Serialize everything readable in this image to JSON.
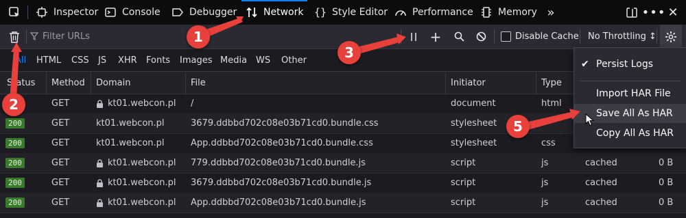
{
  "tabs": [
    {
      "label": "Inspector",
      "icon": "inspector-icon"
    },
    {
      "label": "Console",
      "icon": "console-icon"
    },
    {
      "label": "Debugger",
      "icon": "debugger-icon"
    },
    {
      "label": "Network",
      "icon": "network-icon",
      "active": true
    },
    {
      "label": "Style Editor",
      "icon": "style-editor-icon"
    },
    {
      "label": "Performance",
      "icon": "performance-icon"
    },
    {
      "label": "Memory",
      "icon": "memory-icon"
    }
  ],
  "filterbar": {
    "filter_placeholder": "Filter URLs",
    "disable_cache_label": "Disable Cache",
    "throttling_label": "No Throttling ↕"
  },
  "type_filters": [
    "All",
    "HTML",
    "CSS",
    "JS",
    "XHR",
    "Fonts",
    "Images",
    "Media",
    "WS",
    "Other"
  ],
  "columns": [
    "Status",
    "Method",
    "Domain",
    "File",
    "Initiator",
    "Type"
  ],
  "rows": [
    {
      "status": "",
      "method": "GET",
      "domain": "kt01.webcon.pl",
      "lock": true,
      "file": "/",
      "initiator": "document",
      "type": "html",
      "transferred": "",
      "size": ""
    },
    {
      "status": "200",
      "method": "GET",
      "domain": "kt01.webcon.pl",
      "lock": false,
      "file": "3679.ddbbd702c08e03b71cd0.bundle.css",
      "initiator": "stylesheet",
      "type": "",
      "transferred": "",
      "size": ""
    },
    {
      "status": "200",
      "method": "GET",
      "domain": "kt01.webcon.pl",
      "lock": false,
      "file": "App.ddbbd702c08e03b71cd0.bundle.css",
      "initiator": "stylesheet",
      "type": "css",
      "transferred": "",
      "size": ""
    },
    {
      "status": "200",
      "method": "GET",
      "domain": "kt01.webcon.pl",
      "lock": true,
      "file": "779.ddbbd702c08e03b71cd0.bundle.js",
      "initiator": "script",
      "type": "js",
      "transferred": "cached",
      "size": "0 B"
    },
    {
      "status": "200",
      "method": "GET",
      "domain": "kt01.webcon.pl",
      "lock": true,
      "file": "3679.ddbbd702c08e03b71cd0.bundle.js",
      "initiator": "script",
      "type": "js",
      "transferred": "cached",
      "size": "0 B"
    },
    {
      "status": "200",
      "method": "GET",
      "domain": "kt01.webcon.pl",
      "lock": true,
      "file": "App.ddbbd702c08e03b71cd0.bundle.js",
      "initiator": "script",
      "type": "js",
      "transferred": "cached",
      "size": "0 B"
    }
  ],
  "menu": {
    "persist_logs": "Persist Logs",
    "import_har": "Import HAR File",
    "save_all_har": "Save All As HAR",
    "copy_all_har": "Copy All As HAR"
  },
  "annotations": [
    "1",
    "2",
    "3",
    "5"
  ],
  "colors": {
    "accent": "#0a84ff",
    "annotation": "#e8403a",
    "status_ok": "#3a7a2c"
  }
}
